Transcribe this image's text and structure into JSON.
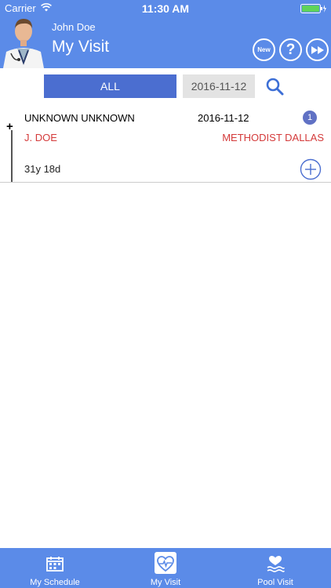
{
  "status_bar": {
    "carrier": "Carrier",
    "time": "11:30 AM",
    "wifi_icon": "wifi-icon",
    "battery_icon": "battery-icon"
  },
  "header": {
    "user_name": "John Doe",
    "title": "My Visit",
    "avatar": "doctor-avatar",
    "buttons": {
      "new_label": "New",
      "help_label": "?",
      "next_icon": "fast-forward-icon"
    },
    "background": "#5b8be8"
  },
  "filter": {
    "all_label": "ALL",
    "date_value": "2016-11-12",
    "search_icon": "search-icon",
    "active_color": "#4b6ed0"
  },
  "visits": [
    {
      "patient": "UNKNOWN UNKNOWN",
      "date": "2016-11-12",
      "count": "1",
      "doctor": "J. DOE",
      "hospital": "METHODIST DALLAS",
      "age": "31y 18d",
      "expand_symbol": "+"
    }
  ],
  "tabbar": {
    "tabs": [
      {
        "label": "My Schedule",
        "icon": "schedule-icon",
        "active": false
      },
      {
        "label": "My Visit",
        "icon": "heart-monitor-icon",
        "active": true
      },
      {
        "label": "Pool Visit",
        "icon": "pool-visit-icon",
        "active": false
      }
    ]
  },
  "colors": {
    "accent": "#5b8be8",
    "highlight_text": "#d43a3a"
  }
}
